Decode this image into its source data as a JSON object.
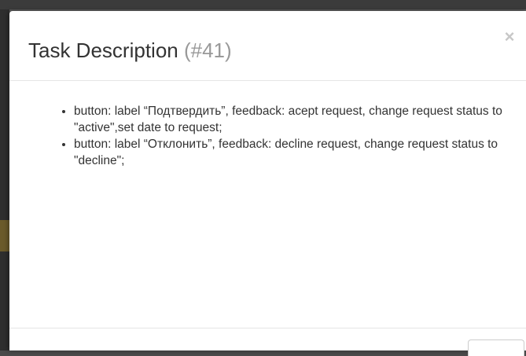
{
  "modal": {
    "title_text": "Task Description",
    "task_id": "(#41)",
    "close_symbol": "×",
    "description_items": [
      "button: label “Подтвердить”, feedback: acept request, change request status to \"active\",set date to request;",
      "button: label “Отклонить”, feedback: decline request, change request status to \"decline\";"
    ]
  },
  "icons": {
    "close": "close-icon"
  },
  "colors": {
    "title": "#333333",
    "task_id": "#999999",
    "close": "#c7c7c7",
    "divider": "#e5e5e5"
  }
}
